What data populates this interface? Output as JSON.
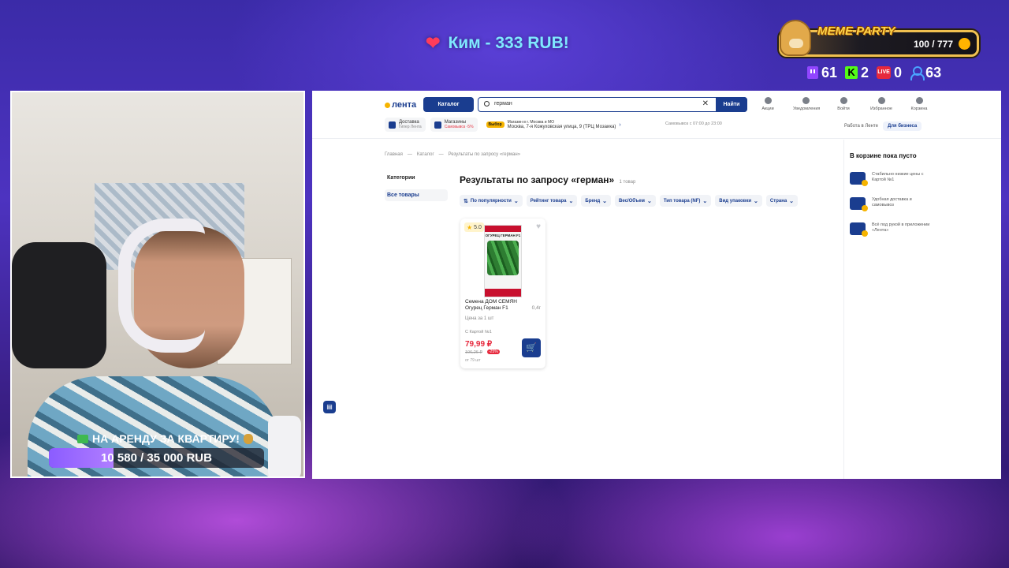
{
  "overlay": {
    "donation_text": "Ким - 333 RUB!",
    "meme_party": {
      "title": "MEME PARTY",
      "count": "100 / 777"
    },
    "stats": {
      "twitch": "61",
      "kick": "2",
      "live": "0",
      "viewers": "63",
      "live_badge": "LIVE"
    },
    "rent": {
      "title": "НА АРЕНДУ ЗА КВАРТИРУ!",
      "progress_text": "10 580 / 35 000 RUB",
      "progress_fraction": 0.302
    }
  },
  "site": {
    "logo": "лента",
    "catalog_label": "Каталог",
    "search": {
      "value": "герман",
      "button": "Найти"
    },
    "top_nav": [
      {
        "label": "Акции",
        "icon": "percent-icon"
      },
      {
        "label": "Уведомления",
        "icon": "bell-icon"
      },
      {
        "label": "Войти",
        "icon": "user-icon"
      },
      {
        "label": "Избранное",
        "icon": "heart-icon"
      },
      {
        "label": "Корзина",
        "icon": "cart-icon"
      }
    ],
    "delivery": {
      "title": "Доставка",
      "sub": "Гипер Лента"
    },
    "stores": {
      "title": "Магазины",
      "sub": "Самовывоз -5%"
    },
    "store_select": {
      "tag": "Выбор",
      "region": "Магазин в г. Москва и МО",
      "address": "Москва, 7-я Кожуховская улица, 9 (ТРЦ Мозаика)"
    },
    "pickup_hours": "Самовывоз с 07:00 до 23:00",
    "links": {
      "work": "Работа в Ленте",
      "business": "Для бизнеса"
    },
    "breadcrumbs": [
      "Главная",
      "—",
      "Каталог",
      "—",
      "Результаты по запросу «герман»"
    ],
    "sidebar": {
      "title": "Категории",
      "active": "Все товары"
    },
    "results": {
      "title": "Результаты по запросу «герман»",
      "count": "1 товар"
    },
    "filters": [
      "По популярности",
      "Рейтинг товара",
      "Бренд",
      "Вес/Объем",
      "Тип товара (NF)",
      "Вид упаковки",
      "Страна"
    ],
    "product": {
      "rating": "5.0",
      "pack_label": "ОГУРЕЦ ГЕРМАН F1",
      "name": "Семена ДОМ СЕМЯН Огурец Герман F1",
      "weight": "0,4г",
      "unit_price": "Цена за 1 шт",
      "card_label": "С Картой №1",
      "price": "79,99 ₽",
      "old_price": "106,26 ₽",
      "discount": "-25%",
      "from_price": "от 79 шт"
    },
    "cart": {
      "title": "В корзине пока пусто",
      "perks": [
        "Стабильно низкие цены с Картой №1",
        "Удобная доставка и самовывоз",
        "Всё под рукой в приложении «Лента»"
      ]
    }
  }
}
